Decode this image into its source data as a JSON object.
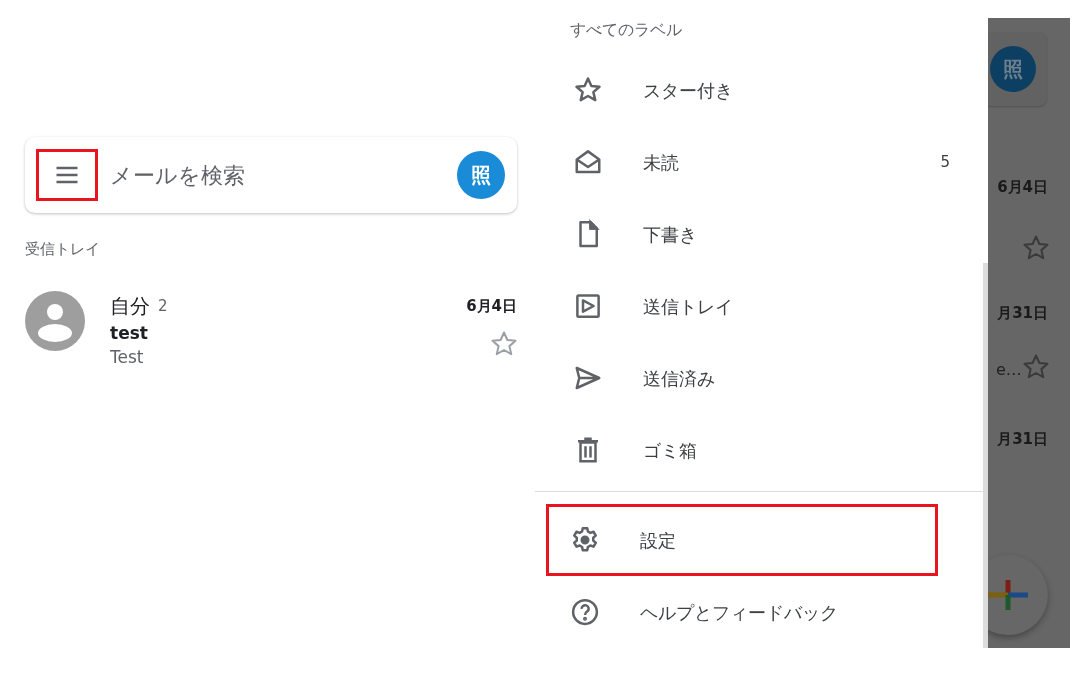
{
  "inbox": {
    "menu_button": {
      "highlighted": true
    },
    "search": {
      "placeholder": "メールを検索"
    },
    "account_initial": "照",
    "folder_title": "受信トレイ",
    "messages": [
      {
        "sender": "自分",
        "count": "2",
        "date": "6月4日",
        "subject": "test",
        "snippet": "Test",
        "starred": false
      }
    ]
  },
  "drawer": {
    "heading": "すべてのラベル",
    "items": [
      {
        "kind": "starred",
        "label": "スター付き"
      },
      {
        "kind": "unread",
        "label": "未読",
        "count": "5"
      },
      {
        "kind": "drafts",
        "label": "下書き"
      },
      {
        "kind": "outbox",
        "label": "送信トレイ"
      },
      {
        "kind": "sent",
        "label": "送信済み"
      },
      {
        "kind": "trash",
        "label": "ゴミ箱"
      }
    ],
    "footer_items": [
      {
        "kind": "settings",
        "label": "設定",
        "highlighted": true
      },
      {
        "kind": "help",
        "label": "ヘルプとフィードバック",
        "highlighted": false
      }
    ]
  },
  "background": {
    "account_initial": "照",
    "rows": [
      {
        "date": "6月4日",
        "starred": false
      },
      {
        "date": "月31日",
        "snippet": "e…",
        "starred": false
      },
      {
        "date": "月31日"
      }
    ]
  }
}
